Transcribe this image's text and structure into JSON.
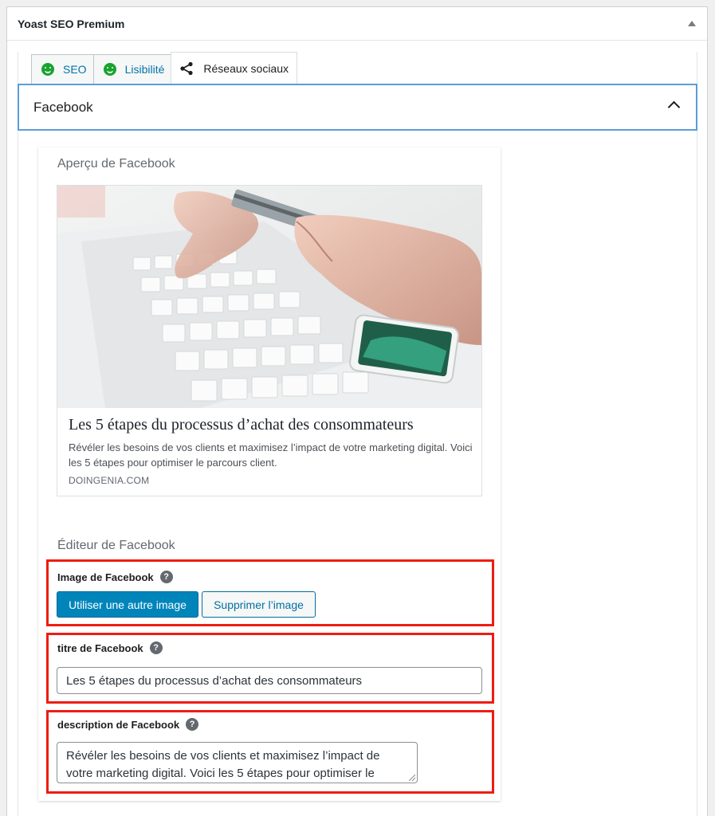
{
  "metabox": {
    "title": "Yoast SEO Premium"
  },
  "tabs": [
    {
      "label": "SEO",
      "icon": "smiley-icon",
      "status_color": "#19a32f"
    },
    {
      "label": "Lisibilité",
      "icon": "smiley-icon",
      "status_color": "#19a32f"
    },
    {
      "label": "Réseaux sociaux",
      "icon": "share-icon",
      "active": true
    }
  ],
  "facebook_section": {
    "title": "Facebook",
    "expanded": true
  },
  "preview": {
    "heading": "Aperçu de Facebook",
    "title": "Les 5 étapes du processus d’achat des consommateurs",
    "description": "Révéler les besoins de vos clients et maximisez l’impact de votre marketing digital. Voici les 5 étapes pour optimiser le parcours client.",
    "domain": "DOINGENIA.COM"
  },
  "editor": {
    "heading": "Éditeur de Facebook",
    "image": {
      "label": "Image de Facebook",
      "use_other_button": "Utiliser une autre image",
      "remove_button": "Supprimer l’image"
    },
    "title": {
      "label": "titre de Facebook",
      "value": "Les 5 étapes du processus d’achat des consommateurs"
    },
    "description": {
      "label": "description de Facebook",
      "value": "Révéler les besoins de vos clients et maximisez l’impact de votre marketing digital. Voici les 5 étapes pour optimiser le"
    },
    "help_glyph": "?"
  },
  "colors": {
    "accent": "#0085ba",
    "highlight_border": "#ee1d12",
    "focus_border": "#5b9dd9"
  }
}
